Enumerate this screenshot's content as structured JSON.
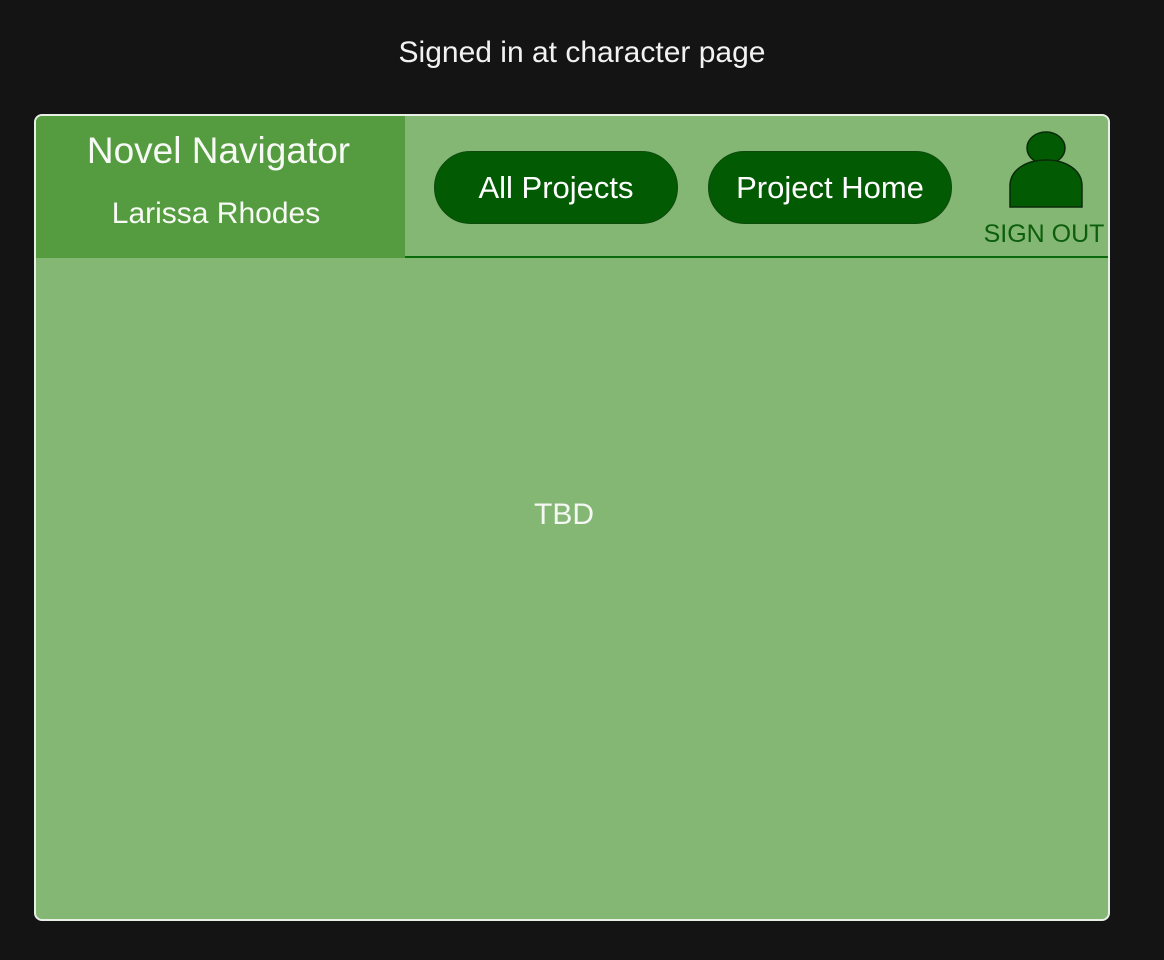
{
  "caption": "Signed in at character page",
  "app": {
    "brand_title": "Novel Navigator",
    "user_name": "Larissa Rhodes",
    "nav": {
      "all_projects_label": "All Projects",
      "project_home_label": "Project Home"
    },
    "account": {
      "icon": "user-avatar-icon",
      "sign_out_label": "SIGN OUT"
    },
    "main": {
      "placeholder_text": "TBD"
    }
  },
  "colors": {
    "page_background": "#141414",
    "frame_background": "#84b674",
    "brand_panel": "#559c40",
    "pill_background": "#025b02",
    "accent_dark_green": "#0c5e0c"
  }
}
